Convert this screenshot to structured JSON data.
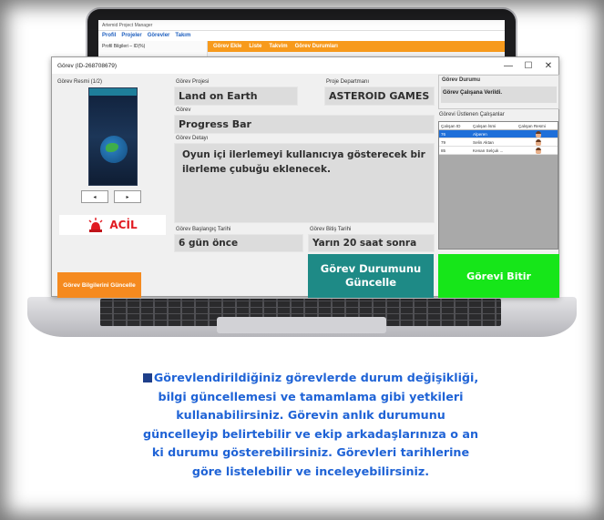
{
  "background_app": {
    "title": "Artemid Project Manager",
    "menu": [
      "Profil",
      "Projeler",
      "Görevler",
      "Takım"
    ],
    "sidebar_header": "Profil Bilgileri – ID(%)",
    "tabs": [
      "Görev Ekle",
      "Liste",
      "Takvim",
      "Görev Durumları"
    ]
  },
  "window": {
    "title": "Görev (ID-268708679)",
    "controls": {
      "minimize": "—",
      "maximize": "☐",
      "close": "✕"
    }
  },
  "image_panel": {
    "label": "Görev Resmi (1/2)",
    "prev": "◂",
    "next": "▸"
  },
  "priority": {
    "text": "ACİL",
    "color": "#e11b22"
  },
  "fields": {
    "project_label": "Görev Projesi",
    "project_value": "Land on Earth",
    "department_label": "Proje Departmanı",
    "department_value": "ASTEROID GAMES",
    "task_label": "Görev",
    "task_value": "Progress Bar",
    "detail_label": "Görev Detayı",
    "detail_value": "Oyun içi ilerlemeyi kullanıcıya gösterecek bir ilerleme çubuğu eklenecek.",
    "start_label": "Görev Başlangıç Tarihi",
    "start_value": "6 gün önce",
    "end_label": "Görev Bitiş Tarihi",
    "end_value": "Yarın 20 saat sonra"
  },
  "status": {
    "label": "Görev Durumu",
    "value": "Görev Çalışana Verildi."
  },
  "staff": {
    "label": "Görevi Üstlenen Çalışanlar",
    "columns": [
      "Çalışan ID",
      "Çalışan İsmi",
      "Çalışan Resmi"
    ],
    "rows": [
      {
        "id": "76",
        "name": "Alperen",
        "selected": true
      },
      {
        "id": "79",
        "name": "Selin Aktan",
        "selected": false
      },
      {
        "id": "85",
        "name": "Kenan Selçuk ...",
        "selected": false
      }
    ]
  },
  "buttons": {
    "update_info": "Görev Bilgilerini Güncelle",
    "update_status": "Görev Durumunu Güncelle",
    "finish": "Görevi Bitir"
  },
  "colors": {
    "orange": "#f58a1f",
    "teal": "#1e8a86",
    "green": "#16e619",
    "accent_blue": "#1f63d6"
  },
  "description": "Görevlendirildiğiniz görevlerde durum değişikliği, bilgi güncellemesi ve tamamlama gibi yetkileri kullanabilirsiniz. Görevin anlık durumunu güncelleyip belirtebilir ve ekip arkadaşlarınıza o an ki durumu gösterebilirsiniz. Görevleri tarihlerine göre listelebilir ve inceleyebilirsiniz."
}
